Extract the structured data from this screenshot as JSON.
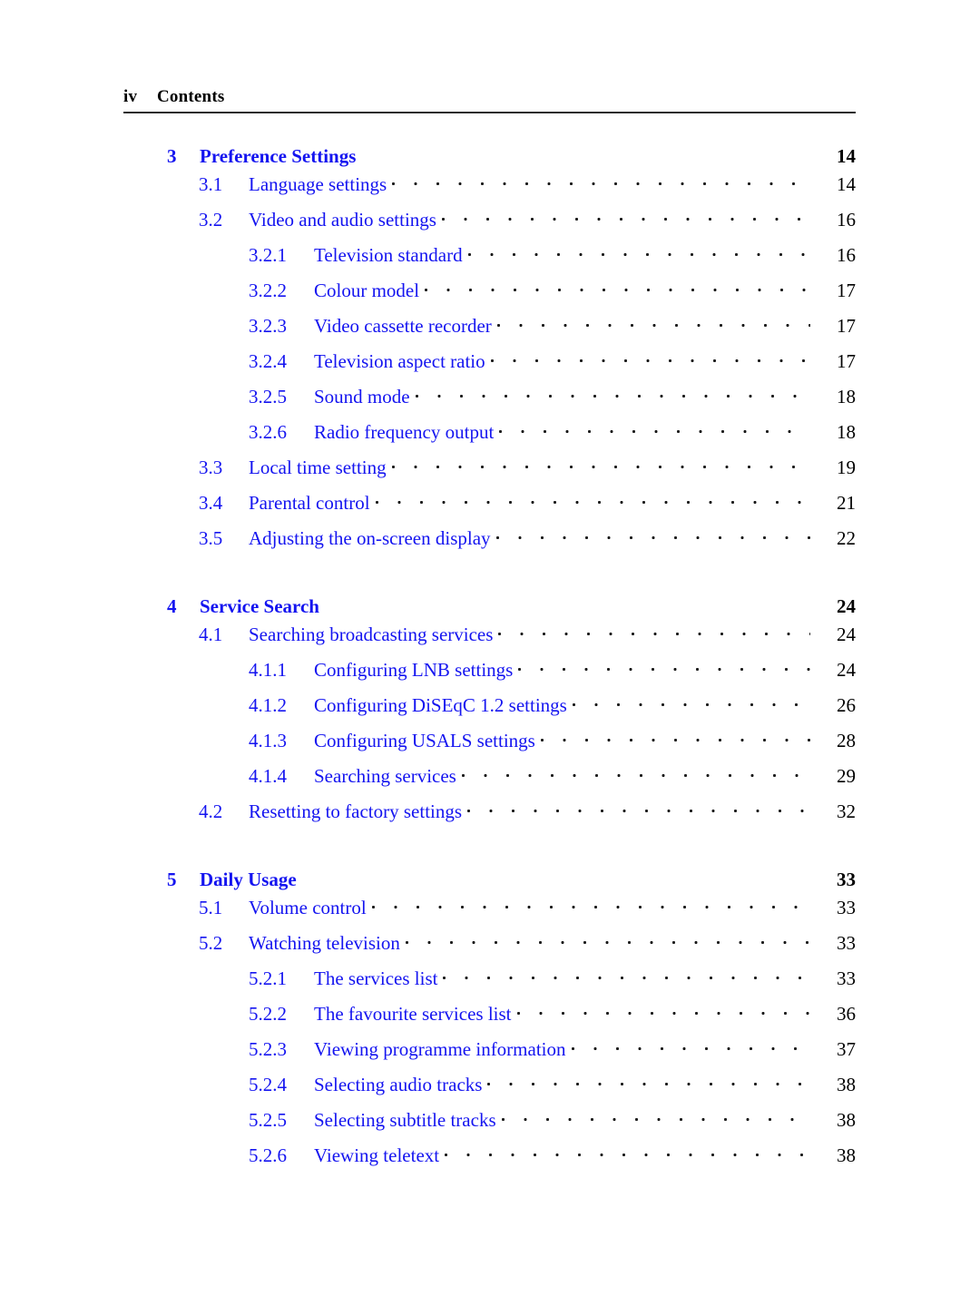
{
  "header": {
    "folio": "iv",
    "title": "Contents"
  },
  "toc": {
    "entries": [
      {
        "level": "chapter",
        "num": "3",
        "title": "Preference Settings",
        "page": "14"
      },
      {
        "level": "section",
        "num": "3.1",
        "title": "Language settings",
        "page": "14"
      },
      {
        "level": "section",
        "num": "3.2",
        "title": "Video and audio settings",
        "page": "16"
      },
      {
        "level": "subsection",
        "num": "3.2.1",
        "title": "Television standard",
        "page": "16"
      },
      {
        "level": "subsection",
        "num": "3.2.2",
        "title": "Colour model",
        "page": "17"
      },
      {
        "level": "subsection",
        "num": "3.2.3",
        "title": "Video cassette recorder",
        "page": "17"
      },
      {
        "level": "subsection",
        "num": "3.2.4",
        "title": "Television aspect ratio",
        "page": "17"
      },
      {
        "level": "subsection",
        "num": "3.2.5",
        "title": "Sound mode",
        "page": "18"
      },
      {
        "level": "subsection",
        "num": "3.2.6",
        "title": "Radio frequency output",
        "page": "18"
      },
      {
        "level": "section",
        "num": "3.3",
        "title": "Local time setting",
        "page": "19"
      },
      {
        "level": "section",
        "num": "3.4",
        "title": "Parental control",
        "page": "21"
      },
      {
        "level": "section",
        "num": "3.5",
        "title": "Adjusting the on-screen display",
        "page": "22"
      },
      {
        "level": "chapter",
        "num": "4",
        "title": "Service Search",
        "page": "24"
      },
      {
        "level": "section",
        "num": "4.1",
        "title": "Searching broadcasting services",
        "page": "24"
      },
      {
        "level": "subsection",
        "num": "4.1.1",
        "title": "Configuring LNB settings",
        "page": "24"
      },
      {
        "level": "subsection",
        "num": "4.1.2",
        "title": "Configuring DiSEqC 1.2 settings",
        "page": "26"
      },
      {
        "level": "subsection",
        "num": "4.1.3",
        "title": "Configuring USALS settings",
        "page": "28"
      },
      {
        "level": "subsection",
        "num": "4.1.4",
        "title": "Searching services",
        "page": "29"
      },
      {
        "level": "section",
        "num": "4.2",
        "title": "Resetting to factory settings",
        "page": "32"
      },
      {
        "level": "chapter",
        "num": "5",
        "title": "Daily Usage",
        "page": "33"
      },
      {
        "level": "section",
        "num": "5.1",
        "title": "Volume control",
        "page": "33"
      },
      {
        "level": "section",
        "num": "5.2",
        "title": "Watching television",
        "page": "33"
      },
      {
        "level": "subsection",
        "num": "5.2.1",
        "title": "The services list",
        "page": "33"
      },
      {
        "level": "subsection",
        "num": "5.2.2",
        "title": "The favourite services list",
        "page": "36"
      },
      {
        "level": "subsection",
        "num": "5.2.3",
        "title": "Viewing programme information",
        "page": "37"
      },
      {
        "level": "subsection",
        "num": "5.2.4",
        "title": "Selecting audio tracks",
        "page": "38"
      },
      {
        "level": "subsection",
        "num": "5.2.5",
        "title": "Selecting subtitle tracks",
        "page": "38"
      },
      {
        "level": "subsection",
        "num": "5.2.6",
        "title": "Viewing teletext",
        "page": "38"
      }
    ]
  },
  "colors": {
    "link_blue": "#1414f0",
    "text_black": "#000000",
    "rule_gray": "#2b2b2b"
  }
}
